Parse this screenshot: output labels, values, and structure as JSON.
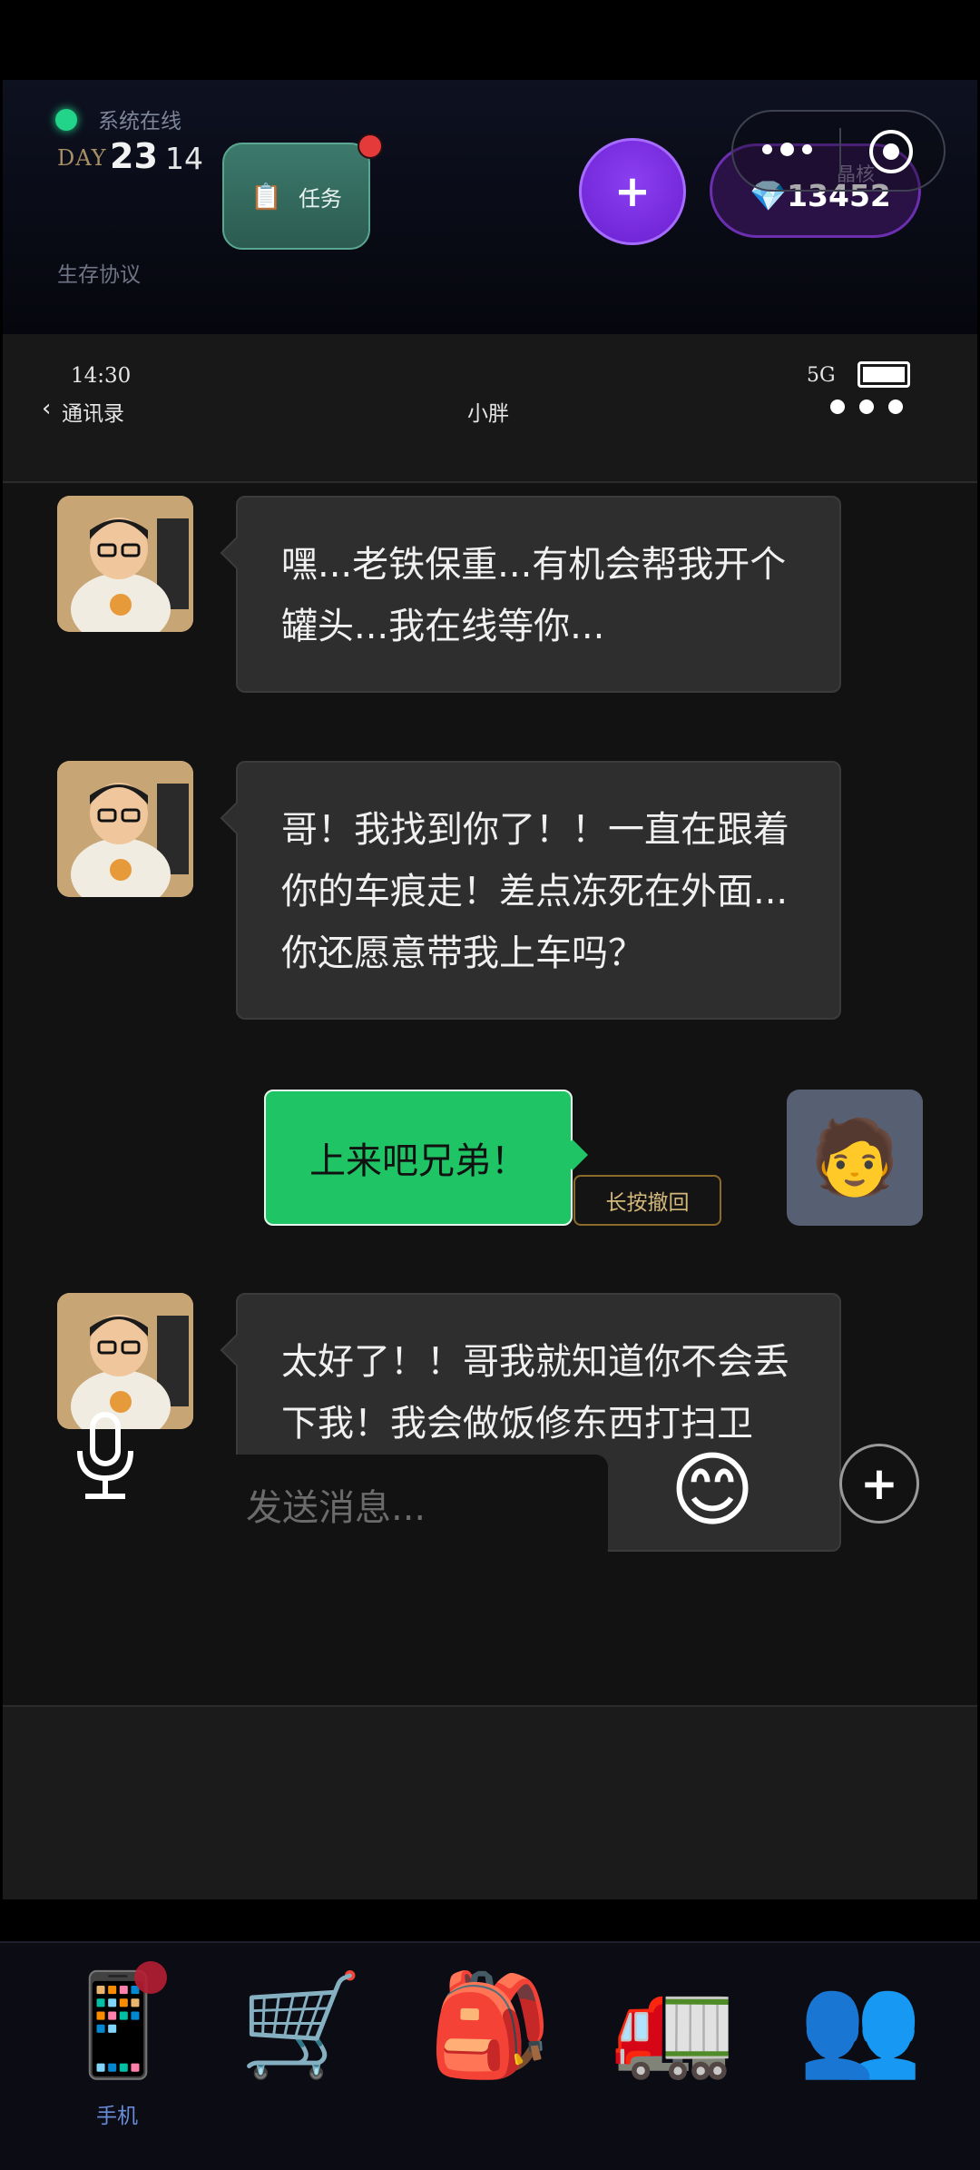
{
  "hud": {
    "status_text": "系统在线",
    "day_label": "DAY",
    "day_number": "23",
    "day_sub": "14",
    "protocol": "生存协议",
    "task_label": "任务",
    "task_icon": "clipboard-icon",
    "add_button": "+",
    "crystal_label": "晶核",
    "crystal_value": "💎13452",
    "colors": {
      "online": "#22d38a",
      "purple": "#7a2fe6",
      "task": "#3c7a6c"
    }
  },
  "phone_status": {
    "time": "14:30",
    "network": "5G",
    "back_chevron": "‹",
    "back_label": "通讯录",
    "chat_title": "小胖"
  },
  "messages": [
    {
      "from": "other",
      "text": "嘿...老铁保重...有机会帮我开个罐头...我在线等你..."
    },
    {
      "from": "other",
      "text": "哥！我找到你了！！一直在跟着你的车痕走！差点冻死在外面...你还愿意带我上车吗？"
    },
    {
      "from": "me",
      "text": "上来吧兄弟！",
      "recall_label": "长按撤回",
      "avatar_emoji": "🧑"
    },
    {
      "from": "other",
      "text": "太好了！！哥我就知道你不会丢下我！我会做饭修东西打扫卫生！什么都干！"
    }
  ],
  "input": {
    "placeholder": "发送消息...",
    "emoji": "😊",
    "plus": "+"
  },
  "nav": {
    "items": [
      {
        "icon": "📱",
        "label": "手机",
        "active": true
      },
      {
        "icon": "🛒"
      },
      {
        "icon": "🎒"
      },
      {
        "icon": "🚛"
      },
      {
        "icon": "👥"
      }
    ]
  }
}
